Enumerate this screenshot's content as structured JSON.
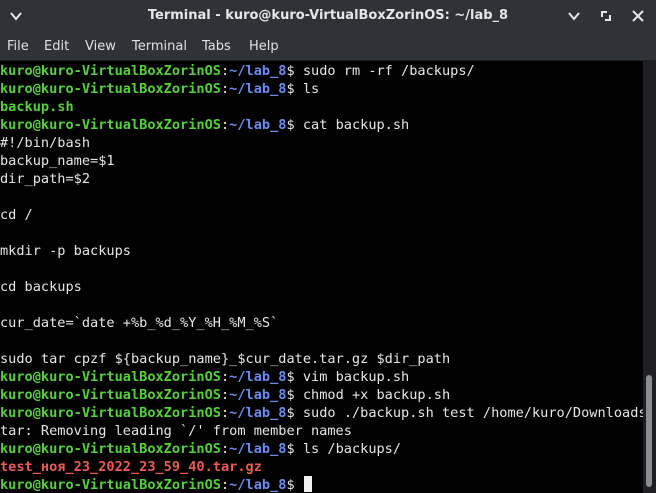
{
  "window": {
    "title": "Terminal - kuro@kuro-VirtualBoxZorinOS: ~/lab_8"
  },
  "titlebar_icons": [
    "chevron-down-icon",
    "minimize-icon",
    "maximize-icon",
    "close-icon"
  ],
  "menu": [
    "File",
    "Edit",
    "View",
    "Terminal",
    "Tabs",
    "Help"
  ],
  "prompt": {
    "user_host": "kuro@kuro-VirtualBoxZorinOS",
    "sep": ":",
    "path": "~/lab_8",
    "symbol": "$"
  },
  "lines": [
    {
      "type": "prompt",
      "cmd": " sudo rm -rf /backups/"
    },
    {
      "type": "prompt",
      "cmd": " ls"
    },
    {
      "type": "green",
      "text": "backup.sh"
    },
    {
      "type": "prompt",
      "cmd": " cat backup.sh"
    },
    {
      "type": "out",
      "text": "#!/bin/bash"
    },
    {
      "type": "out",
      "text": "backup_name=$1"
    },
    {
      "type": "out",
      "text": "dir_path=$2"
    },
    {
      "type": "out",
      "text": ""
    },
    {
      "type": "out",
      "text": "cd /"
    },
    {
      "type": "out",
      "text": ""
    },
    {
      "type": "out",
      "text": "mkdir -p backups"
    },
    {
      "type": "out",
      "text": ""
    },
    {
      "type": "out",
      "text": "cd backups"
    },
    {
      "type": "out",
      "text": ""
    },
    {
      "type": "out",
      "text": "cur_date=`date +%b_%d_%Y_%H_%M_%S`"
    },
    {
      "type": "out",
      "text": ""
    },
    {
      "type": "out",
      "text": "sudo tar cpzf ${backup_name}_$cur_date.tar.gz $dir_path"
    },
    {
      "type": "prompt",
      "cmd": " vim backup.sh"
    },
    {
      "type": "prompt",
      "cmd": " chmod +x backup.sh"
    },
    {
      "type": "prompt",
      "cmd": " sudo ./backup.sh test /home/kuro/Downloads/"
    },
    {
      "type": "out",
      "text": "tar: Removing leading `/' from member names"
    },
    {
      "type": "prompt",
      "cmd": " ls /backups/"
    },
    {
      "type": "red",
      "text": "test_ноя_23_2022_23_59_40.tar.gz"
    },
    {
      "type": "prompt",
      "cmd": " ",
      "cursor": true
    }
  ],
  "colors": {
    "user": "#52d236",
    "path": "#6b8df0",
    "archive": "#ef5a50",
    "background": "#000000"
  }
}
